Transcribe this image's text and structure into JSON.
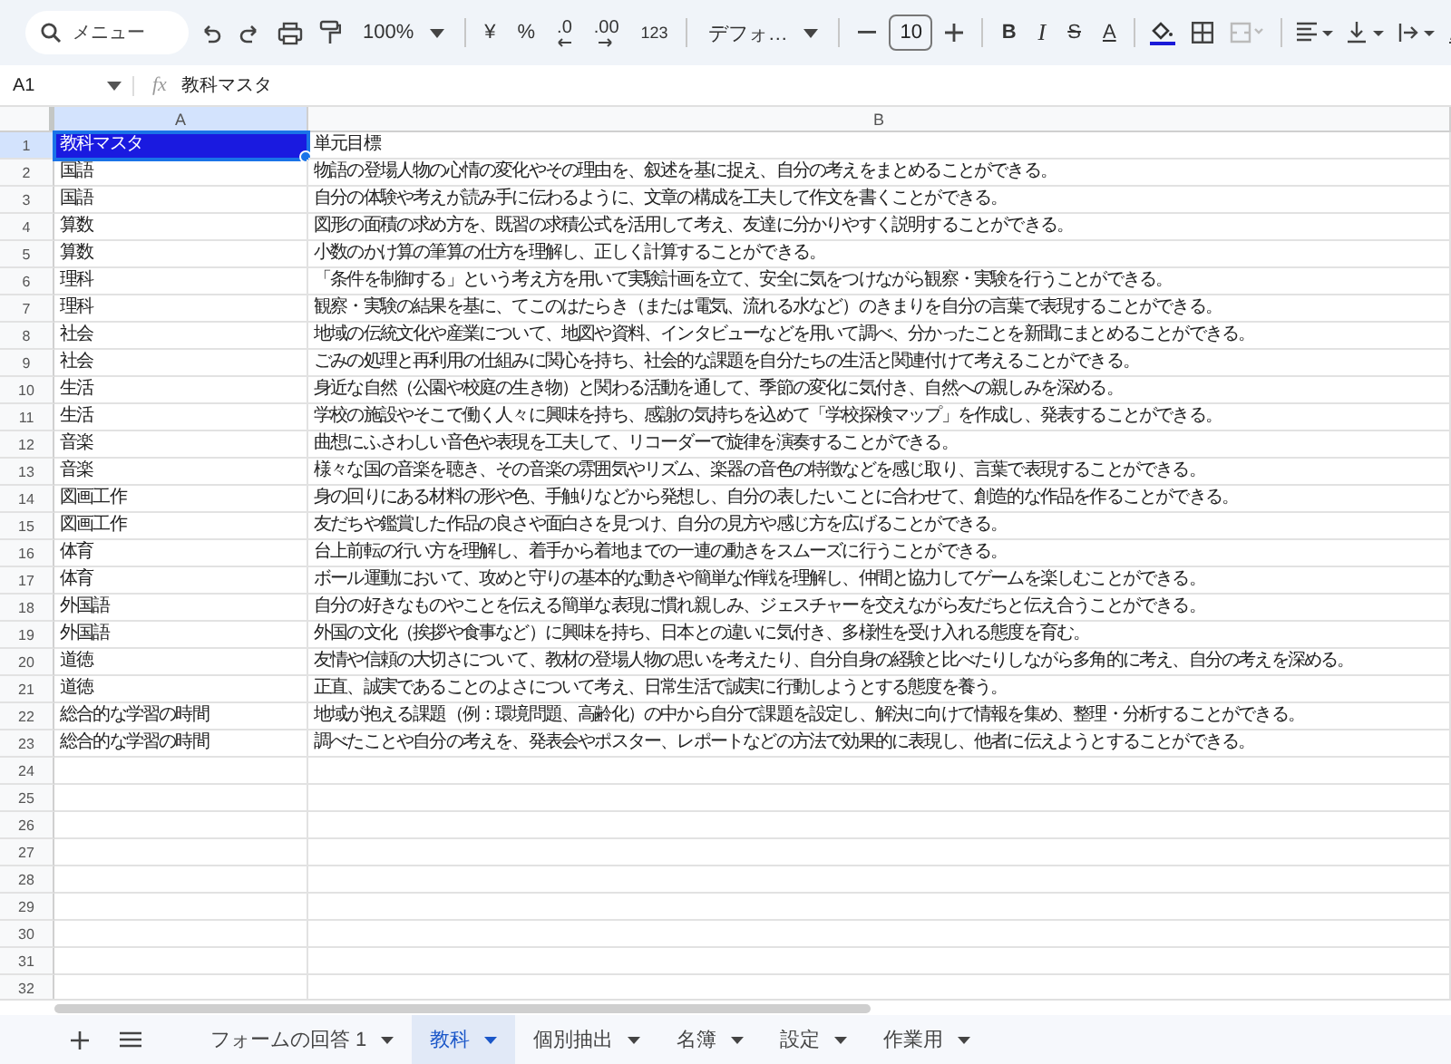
{
  "toolbar": {
    "search_placeholder": "メニュー",
    "zoom": "100%",
    "currency": "¥",
    "percent": "%",
    "decrease_decimal": ".0",
    "increase_decimal": ".00",
    "number_format": "123",
    "font": "デフォ…",
    "font_size": "10",
    "bold": "B",
    "italic": "I",
    "strikethrough": "S",
    "text_color": "A"
  },
  "name_box": "A1",
  "formula_label": "fx",
  "formula": "教科マスタ",
  "columns": [
    "A",
    "B"
  ],
  "rows": [
    {
      "number": "1",
      "a": "教科マスタ",
      "b": "単元目標",
      "selected": true
    },
    {
      "number": "2",
      "a": "国語",
      "b": "物語の登場人物の心情の変化やその理由を、叙述を基に捉え、自分の考えをまとめることができる。",
      "selected": false
    },
    {
      "number": "3",
      "a": "国語",
      "b": "自分の体験や考えが読み手に伝わるように、文章の構成を工夫して作文を書くことができる。",
      "selected": false
    },
    {
      "number": "4",
      "a": "算数",
      "b": "図形の面積の求め方を、既習の求積公式を活用して考え、友達に分かりやすく説明することができる。",
      "selected": false
    },
    {
      "number": "5",
      "a": "算数",
      "b": "小数のかけ算の筆算の仕方を理解し、正しく計算することができる。",
      "selected": false
    },
    {
      "number": "6",
      "a": "理科",
      "b": "「条件を制御する」という考え方を用いて実験計画を立て、安全に気をつけながら観察・実験を行うことができる。",
      "selected": false
    },
    {
      "number": "7",
      "a": "理科",
      "b": "観察・実験の結果を基に、てこのはたらき（または電気、流れる水など）のきまりを自分の言葉で表現することができる。",
      "selected": false
    },
    {
      "number": "8",
      "a": "社会",
      "b": "地域の伝統文化や産業について、地図や資料、インタビューなどを用いて調べ、分かったことを新聞にまとめることができる。",
      "selected": false
    },
    {
      "number": "9",
      "a": "社会",
      "b": "ごみの処理と再利用の仕組みに関心を持ち、社会的な課題を自分たちの生活と関連付けて考えることができる。",
      "selected": false
    },
    {
      "number": "10",
      "a": "生活",
      "b": "身近な自然（公園や校庭の生き物）と関わる活動を通して、季節の変化に気付き、自然への親しみを深める。",
      "selected": false
    },
    {
      "number": "11",
      "a": "生活",
      "b": "学校の施設やそこで働く人々に興味を持ち、感謝の気持ちを込めて「学校探検マップ」を作成し、発表することができる。",
      "selected": false
    },
    {
      "number": "12",
      "a": "音楽",
      "b": "曲想にふさわしい音色や表現を工夫して、リコーダーで旋律を演奏することができる。",
      "selected": false
    },
    {
      "number": "13",
      "a": "音楽",
      "b": "様々な国の音楽を聴き、その音楽の雰囲気やリズム、楽器の音色の特徴などを感じ取り、言葉で表現することができる。",
      "selected": false
    },
    {
      "number": "14",
      "a": "図画工作",
      "b": "身の回りにある材料の形や色、手触りなどから発想し、自分の表したいことに合わせて、創造的な作品を作ることができる。",
      "selected": false
    },
    {
      "number": "15",
      "a": "図画工作",
      "b": "友だちや鑑賞した作品の良さや面白さを見つけ、自分の見方や感じ方を広げることができる。",
      "selected": false
    },
    {
      "number": "16",
      "a": "体育",
      "b": "台上前転の行い方を理解し、着手から着地までの一連の動きをスムーズに行うことができる。",
      "selected": false
    },
    {
      "number": "17",
      "a": "体育",
      "b": "ボール運動において、攻めと守りの基本的な動きや簡単な作戦を理解し、仲間と協力してゲームを楽しむことができる。",
      "selected": false
    },
    {
      "number": "18",
      "a": "外国語",
      "b": "自分の好きなものやことを伝える簡単な表現に慣れ親しみ、ジェスチャーを交えながら友だちと伝え合うことができる。",
      "selected": false
    },
    {
      "number": "19",
      "a": "外国語",
      "b": "外国の文化（挨拶や食事など）に興味を持ち、日本との違いに気付き、多様性を受け入れる態度を育む。",
      "selected": false
    },
    {
      "number": "20",
      "a": "道徳",
      "b": "友情や信頼の大切さについて、教材の登場人物の思いを考えたり、自分自身の経験と比べたりしながら多角的に考え、自分の考えを深める。",
      "selected": false
    },
    {
      "number": "21",
      "a": "道徳",
      "b": "正直、誠実であることのよさについて考え、日常生活で誠実に行動しようとする態度を養う。",
      "selected": false
    },
    {
      "number": "22",
      "a": "総合的な学習の時間",
      "b": "地域が抱える課題（例：環境問題、高齢化）の中から自分で課題を設定し、解決に向けて情報を集め、整理・分析することができる。",
      "selected": false
    },
    {
      "number": "23",
      "a": "総合的な学習の時間",
      "b": "調べたことや自分の考えを、発表会やポスター、レポートなどの方法で効果的に表現し、他者に伝えようとすることができる。",
      "selected": false
    },
    {
      "number": "24"
    },
    {
      "number": "25"
    },
    {
      "number": "26"
    },
    {
      "number": "27"
    },
    {
      "number": "28"
    },
    {
      "number": "29"
    },
    {
      "number": "30"
    },
    {
      "number": "31"
    },
    {
      "number": "32"
    }
  ],
  "sheet_tabs": [
    {
      "label": "フォームの回答 1",
      "selected": false
    },
    {
      "label": "教科",
      "selected": true
    },
    {
      "label": "個別抽出",
      "selected": false
    },
    {
      "label": "名簿",
      "selected": false
    },
    {
      "label": "設定",
      "selected": false
    },
    {
      "label": "作業用",
      "selected": false
    }
  ]
}
